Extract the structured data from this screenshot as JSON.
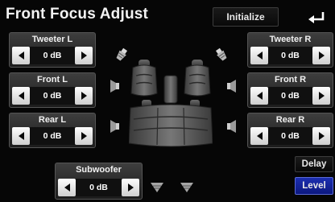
{
  "header": {
    "title": "Front Focus Adjust",
    "initialize_label": "Initialize"
  },
  "speakers": {
    "tweeter_l": {
      "label": "Tweeter L",
      "value": "0 dB"
    },
    "front_l": {
      "label": "Front L",
      "value": "0 dB"
    },
    "rear_l": {
      "label": "Rear L",
      "value": "0 dB"
    },
    "tweeter_r": {
      "label": "Tweeter R",
      "value": "0 dB"
    },
    "front_r": {
      "label": "Front R",
      "value": "0 dB"
    },
    "rear_r": {
      "label": "Rear R",
      "value": "0 dB"
    },
    "subwoofer": {
      "label": "Subwoofer",
      "value": "0 dB"
    }
  },
  "modes": {
    "delay_label": "Delay",
    "level_label": "Level"
  },
  "colors": {
    "background": "#060606",
    "level_active": "#1c2fb0",
    "arrow_button": "#f2f2f2"
  },
  "icons": [
    "back-arrow-icon",
    "tweeter-icon",
    "speaker-icon",
    "subwoofer-icon",
    "car-seats-icon"
  ]
}
